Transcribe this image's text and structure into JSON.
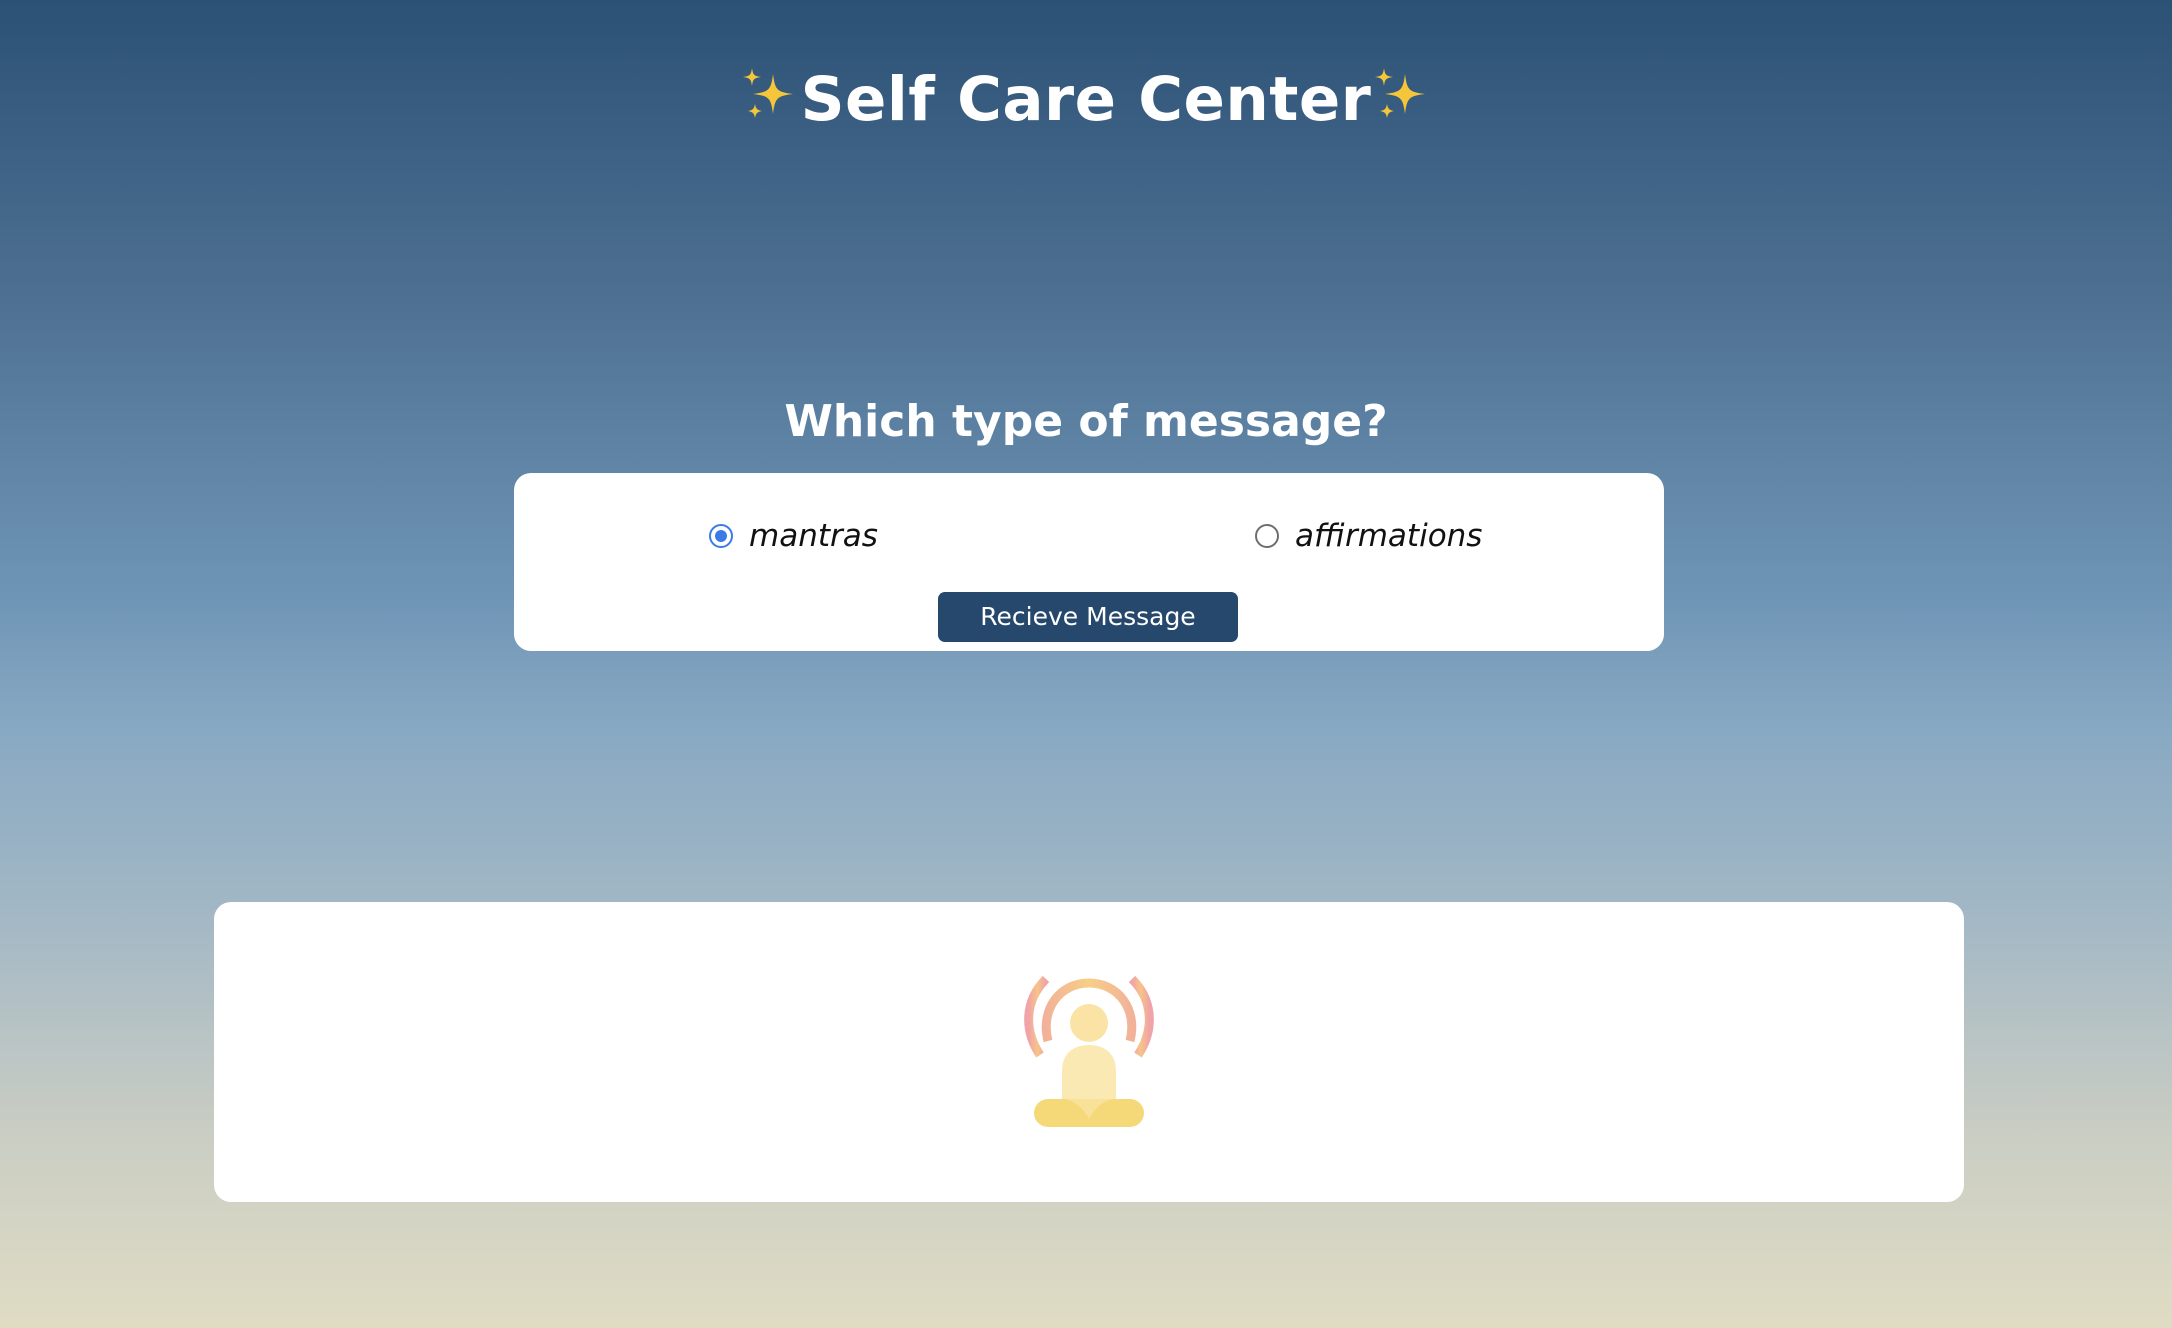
{
  "header": {
    "title": "Self Care Center",
    "left_icon": "sparkles-icon",
    "right_icon": "sparkles-icon"
  },
  "form": {
    "prompt": "Which type of message?",
    "options": [
      {
        "label": "mantras",
        "checked": true
      },
      {
        "label": "affirmations",
        "checked": false
      }
    ],
    "submit_label": "Recieve Message"
  },
  "message_panel": {
    "icon": "meditation-icon"
  },
  "colors": {
    "button": "#26486d",
    "radio_accent": "#3b7be6",
    "sparkle": "#f6c63a",
    "icon_ring": "#f0a8a8",
    "icon_figure": "#fbe9b4",
    "icon_base": "#f5d978"
  }
}
